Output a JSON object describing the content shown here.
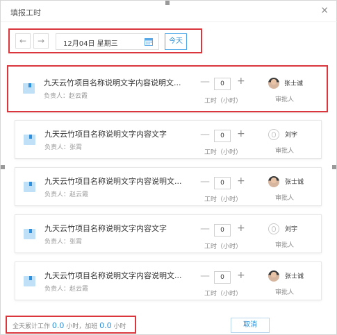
{
  "dialog": {
    "title": "填报工时",
    "close_glyph": "×"
  },
  "toolbar": {
    "prev_glyph": "←",
    "next_glyph": "→",
    "date_value": "12月04日  星期三",
    "today_label": "今天"
  },
  "tasks": [
    {
      "name": "九天云竹项目名称说明文字内容说明文...",
      "owner": "负责人：赵云霞",
      "hours": "0",
      "hours_label": "工时（小时）",
      "approver": "张士诚",
      "approver_label": "审批人",
      "avatar": "photo"
    },
    {
      "name": "九天云竹项目名称说明文字内容文字",
      "owner": "负责人：张霄",
      "hours": "0",
      "hours_label": "工时（小时）",
      "approver": "刘宇",
      "approver_label": "审批人",
      "avatar": "blank"
    },
    {
      "name": "九天云竹项目名称说明文字内容说明文...",
      "owner": "负责人：赵云霞",
      "hours": "0",
      "hours_label": "工时（小时）",
      "approver": "张士诚",
      "approver_label": "审批人",
      "avatar": "photo"
    },
    {
      "name": "九天云竹项目名称说明文字内容文字",
      "owner": "负责人：张霄",
      "hours": "0",
      "hours_label": "工时（小时）",
      "approver": "刘宇",
      "approver_label": "审批人",
      "avatar": "blank"
    },
    {
      "name": "九天云竹项目名称说明文字内容说明文...",
      "owner": "负责人：赵云霞",
      "hours": "0",
      "hours_label": "工时（小时）",
      "approver": "张士诚",
      "approver_label": "审批人",
      "avatar": "photo"
    }
  ],
  "controls": {
    "minus_glyph": "—",
    "plus_glyph": "+"
  },
  "footer": {
    "prefix": "全天累计工作",
    "work_hours": "0.0",
    "mid": "小时，加班",
    "overtime_hours": "0.0",
    "suffix": "小时",
    "cancel_label": "取消"
  },
  "colors": {
    "accent": "#2f8fd8",
    "highlight_border": "#d9363e",
    "icon_light": "#bfe0f7"
  }
}
